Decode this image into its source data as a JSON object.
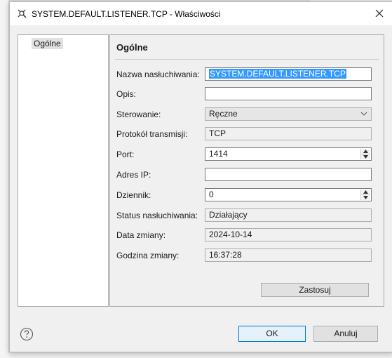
{
  "window": {
    "title": "SYSTEM.DEFAULT.LISTENER.TCP - Właściwości"
  },
  "nav": {
    "items": [
      {
        "label": "Ogólne",
        "selected": true
      }
    ]
  },
  "section": {
    "title": "Ogólne"
  },
  "form": {
    "listener_name": {
      "label": "Nazwa nasłuchiwania:",
      "value": "SYSTEM.DEFAULT.LISTENER.TCP"
    },
    "description": {
      "label": "Opis:",
      "value": ""
    },
    "control": {
      "label": "Sterowanie:",
      "value": "Ręczne"
    },
    "protocol": {
      "label": "Protokół transmisji:",
      "value": "TCP"
    },
    "port": {
      "label": "Port:",
      "value": "1414"
    },
    "ip_address": {
      "label": "Adres IP:",
      "value": ""
    },
    "backlog": {
      "label": "Dziennik:",
      "value": "0"
    },
    "status": {
      "label": "Status nasłuchiwania:",
      "value": "Działający"
    },
    "alter_date": {
      "label": "Data zmiany:",
      "value": "2024-10-14"
    },
    "alter_time": {
      "label": "Godzina zmiany:",
      "value": "16:37:28"
    }
  },
  "buttons": {
    "apply": "Zastosuj",
    "ok": "OK",
    "cancel": "Anuluj"
  },
  "colors": {
    "selection": "#3399ff",
    "ok_border": "#0078d7",
    "dialog_bg": "#f0f0f0"
  }
}
